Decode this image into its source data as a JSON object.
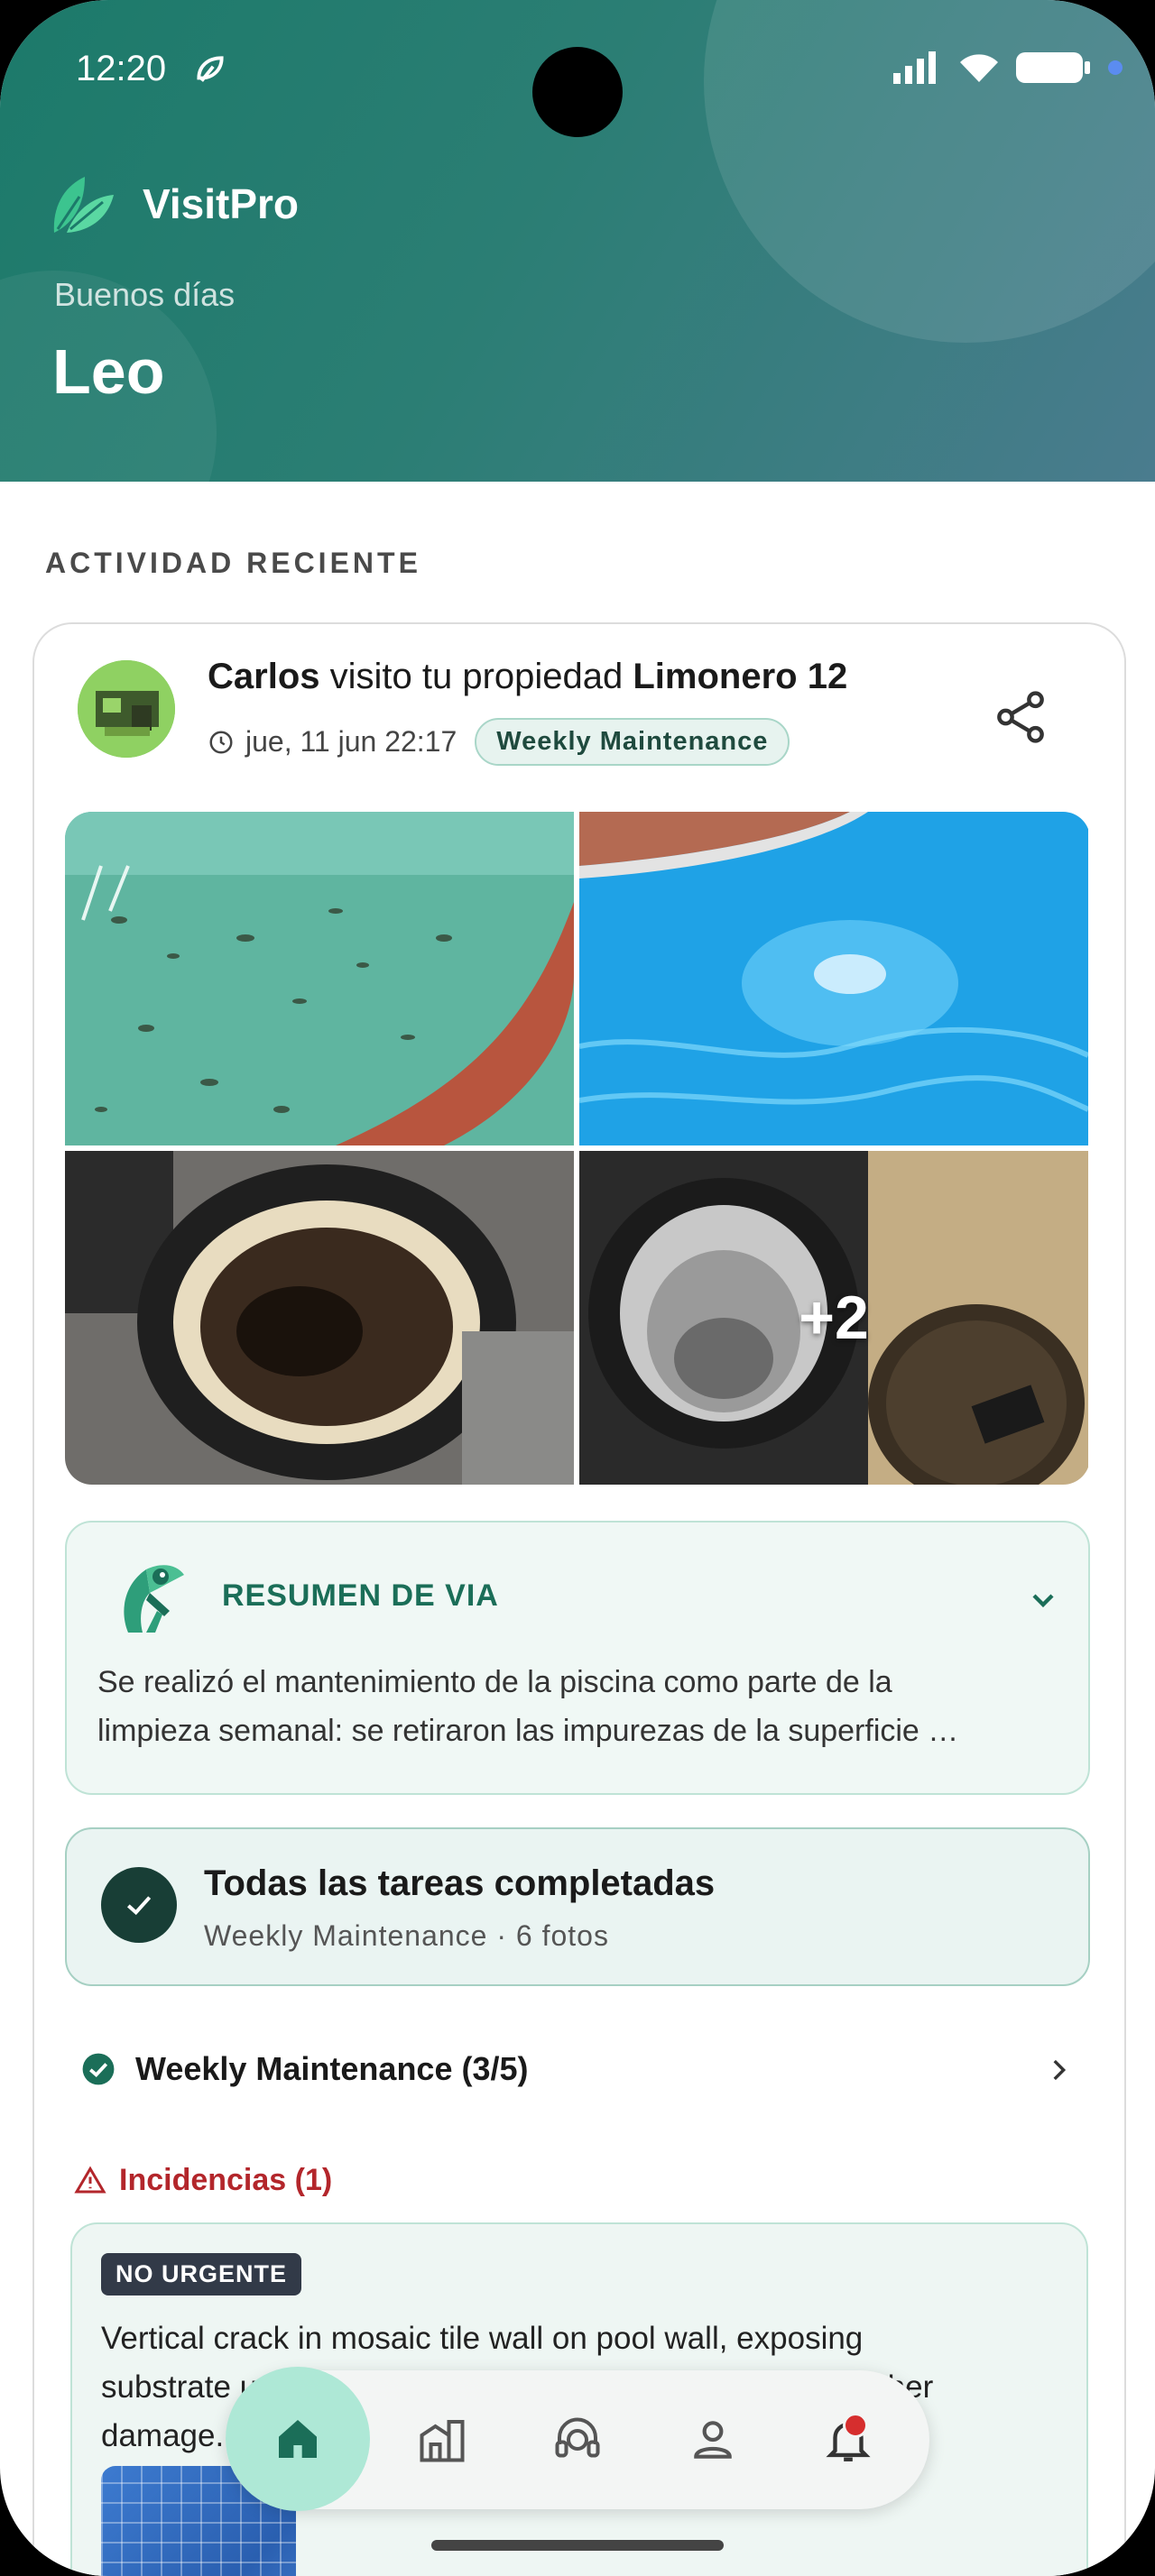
{
  "status_bar": {
    "time": "12:20"
  },
  "brand": {
    "name": "VisitPro",
    "greeting": "Buenos días",
    "user_name": "Leo"
  },
  "activity": {
    "section_title": "ACTIVIDAD RECIENTE",
    "visit": {
      "worker": "Carlos",
      "verb": " visito tu propiedad ",
      "property": "Limonero 12",
      "date": "jue, 11 jun 22:17",
      "tag": "Weekly Maintenance"
    },
    "photos": {
      "more_count": "+2"
    },
    "summary": {
      "title": "RESUMEN DE VIA",
      "line1": "Se realizó el mantenimiento de la piscina como parte de la",
      "line2": "limpieza semanal: se retiraron las impurezas de la superficie …"
    },
    "tasks": {
      "title": "Todas las tareas completadas",
      "subtitle": "Weekly Maintenance · 6 fotos"
    },
    "checklist": {
      "label": "Weekly Maintenance (3/5)"
    },
    "incidents": {
      "header": "Incidencias (1)",
      "urgency": "NO URGENTE",
      "line1": "Vertical crack in mosaic tile wall on pool wall, exposing",
      "line2": "substrate underneath. Should be repaired to prevent further",
      "line3": "damage."
    }
  },
  "colors": {
    "header_start": "#1c7a6a",
    "header_end": "#4a7c8e",
    "accent": "#1b6e58",
    "alert": "#b3262b",
    "home_active": "#aee8d6"
  },
  "icons": [
    "leaf-logo-icon",
    "clock-icon",
    "share-icon",
    "via-mascot-icon",
    "chevron-down-icon",
    "check-icon",
    "check-circle-icon",
    "chevron-right-icon",
    "warning-icon",
    "home-icon",
    "building-icon",
    "support-agent-icon",
    "person-icon",
    "bell-icon"
  ]
}
